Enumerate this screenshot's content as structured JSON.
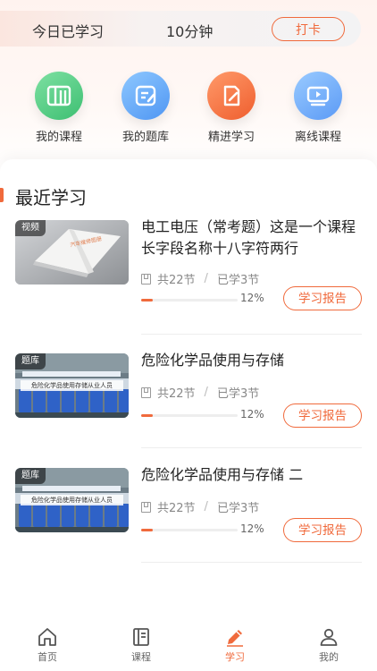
{
  "checkin": {
    "label": "今日已学习",
    "duration": "10分钟",
    "button": "打卡"
  },
  "shortcuts": [
    {
      "label": "我的课程",
      "icon": "course-book-icon",
      "color": "#3dbf72"
    },
    {
      "label": "我的题库",
      "icon": "question-bank-icon",
      "color": "#4f96f3"
    },
    {
      "label": "精进学习",
      "icon": "advanced-study-icon",
      "color": "#ef5e2e"
    },
    {
      "label": "离线课程",
      "icon": "offline-video-icon",
      "color": "#5b9af6"
    }
  ],
  "recent": {
    "title": "最近学习",
    "courses": [
      {
        "tag": "视频",
        "title": "电工电压（常考题）这是一个课程长字段名称十八字符两行",
        "total": "共22节",
        "learned": "已学3节",
        "progress": 12,
        "progress_label": "12%",
        "action": "学习报告",
        "thumb_caption": ""
      },
      {
        "tag": "题库",
        "title": "危险化学品使用与存储",
        "total": "共22节",
        "learned": "已学3节",
        "progress": 12,
        "progress_label": "12%",
        "action": "学习报告",
        "thumb_caption": "危险化学品使用存储从业人员"
      },
      {
        "tag": "题库",
        "title": "危险化学品使用与存储 二",
        "total": "共22节",
        "learned": "已学3节",
        "progress": 12,
        "progress_label": "12%",
        "action": "学习报告",
        "thumb_caption": "危险化学品使用存储从业人员"
      }
    ]
  },
  "tabs": [
    {
      "label": "首页",
      "icon": "home-icon",
      "active": false
    },
    {
      "label": "课程",
      "icon": "course-icon",
      "active": false
    },
    {
      "label": "学习",
      "icon": "pencil-icon",
      "active": true
    },
    {
      "label": "我的",
      "icon": "user-icon",
      "active": false
    }
  ],
  "colors": {
    "accent": "#f06a3c",
    "text": "#222222",
    "muted": "#888888"
  }
}
